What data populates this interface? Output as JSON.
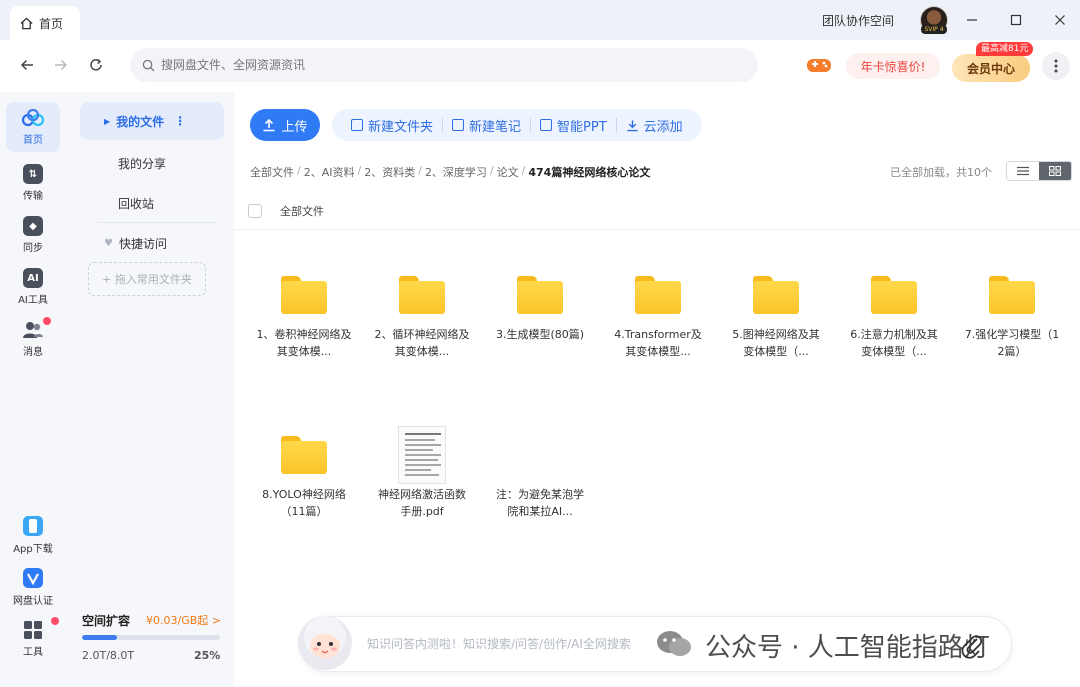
{
  "titlebar": {
    "tab_label": "首页",
    "team_space": "团队协作空间",
    "avatar_badge": "SVIP 4"
  },
  "navbar": {
    "search_placeholder": "搜网盘文件、全网资源资讯",
    "promo": "年卡惊喜价!",
    "vip_center": "会员中心",
    "vip_tag": "最高减81元"
  },
  "rail": {
    "items": [
      {
        "label": "首页",
        "icon": "cloud-home-icon"
      },
      {
        "label": "传输",
        "icon": "transfer-icon"
      },
      {
        "label": "同步",
        "icon": "sync-icon"
      },
      {
        "label": "AI工具",
        "icon": "ai-tool-icon"
      },
      {
        "label": "消息",
        "icon": "message-icon"
      },
      {
        "label": "App下载",
        "icon": "app-download-icon"
      },
      {
        "label": "网盘认证",
        "icon": "verify-icon"
      },
      {
        "label": "工具",
        "icon": "tools-icon"
      }
    ]
  },
  "sidebar": {
    "my_files": "我的文件",
    "my_share": "我的分享",
    "recycle": "回收站",
    "quick_access": "快捷访问",
    "drop_hint": "+ 拖入常用文件夹",
    "storage": {
      "title": "空间扩容",
      "price": "¥0.03/GB起 >",
      "used": "2.0T/8.0T",
      "percent": "25%",
      "fraction": 0.25
    }
  },
  "toolbar": {
    "upload": "上传",
    "new_folder": "新建文件夹",
    "new_note": "新建笔记",
    "smart_ppt": "智能PPT",
    "cloud_add": "云添加"
  },
  "breadcrumb": [
    "全部文件",
    "2、AI资料",
    "2、资料类",
    "2、深度学习",
    "论文",
    "474篇神经网络核心论文"
  ],
  "status": "已全部加载，共10个",
  "list_header": "全部文件",
  "files": [
    {
      "name": "1、卷积神经网络及其变体模...",
      "type": "folder"
    },
    {
      "name": "2、循环神经网络及其变体模...",
      "type": "folder"
    },
    {
      "name": "3.生成模型(80篇)",
      "type": "folder"
    },
    {
      "name": "4.Transformer及其变体模型...",
      "type": "folder"
    },
    {
      "name": "5.图神经网络及其变体模型（...",
      "type": "folder"
    },
    {
      "name": "6.注意力机制及其变体模型（...",
      "type": "folder"
    },
    {
      "name": "7.强化学习模型（12篇）",
      "type": "folder"
    },
    {
      "name": "8.YOLO神经网络（11篇）",
      "type": "folder"
    },
    {
      "name": "神经网络激活函数手册.pdf",
      "type": "pdf"
    },
    {
      "name": "注：为避免某泡学院和某拉AI...",
      "type": "text"
    }
  ],
  "assistant": {
    "placeholder": "知识问答内测啦！知识搜索/问答/创作/AI全网搜索",
    "watermark": "公众号 · 人工智能指路灯"
  },
  "colors": {
    "accent": "#2f7bf5",
    "folder": "#fcc42a",
    "promo_red": "#e8433c"
  }
}
